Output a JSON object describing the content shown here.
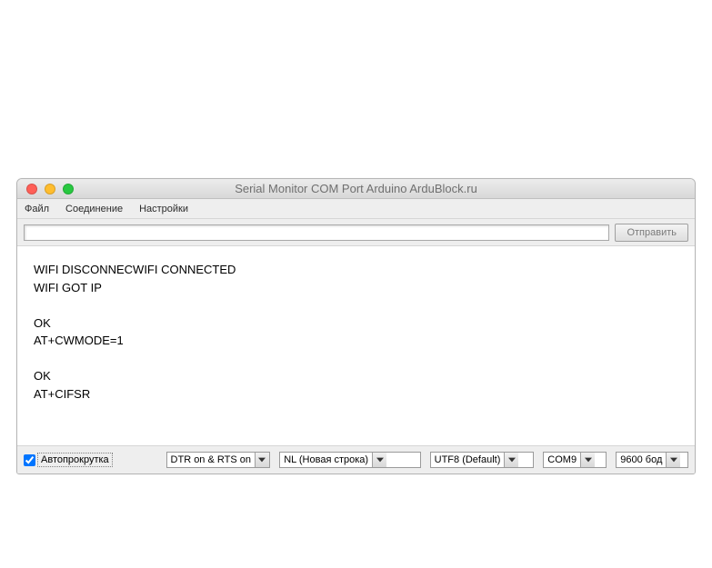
{
  "window": {
    "title": "Serial Monitor COM Port Arduino ArduBlock.ru"
  },
  "menu": {
    "file": "Файл",
    "connection": "Соединение",
    "settings": "Настройки"
  },
  "send": {
    "input_value": "",
    "button": "Отправить"
  },
  "console": {
    "text": "WIFI DISCONNECWIFI CONNECTED\nWIFI GOT IP\n\nOK\nAT+CWMODE=1\n\nOK\nAT+CIFSR"
  },
  "bottom": {
    "autoscroll": "Автопрокрутка",
    "dtr_rts": "DTR on  & RTS on",
    "line_ending": "NL (Новая строка)",
    "encoding": "UTF8 (Default)",
    "port": "COM9",
    "baud": "9600 бод"
  }
}
